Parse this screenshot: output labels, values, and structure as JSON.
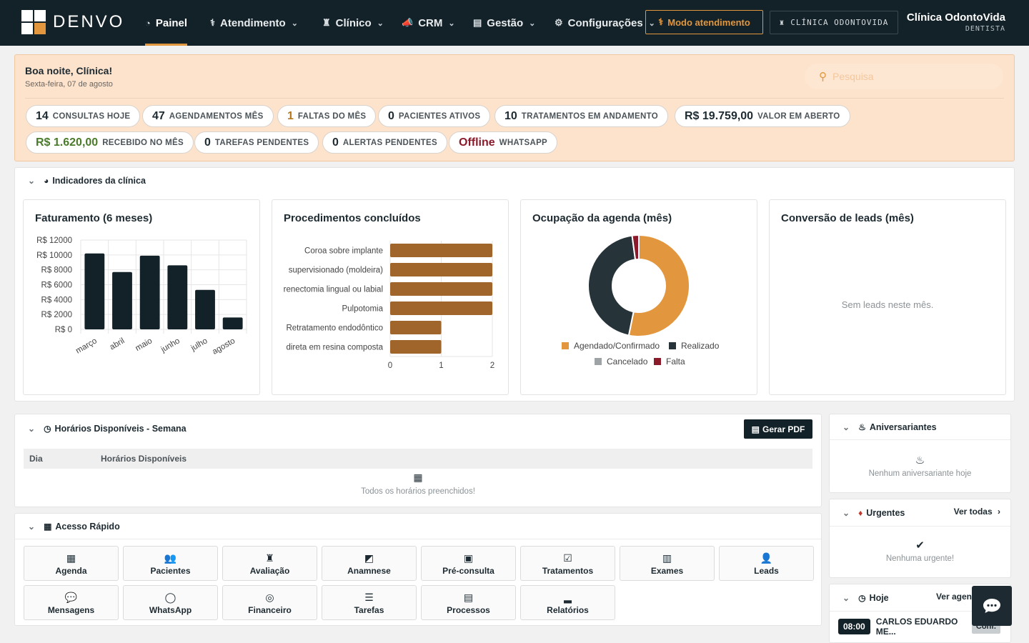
{
  "app": {
    "brand": "DENVO"
  },
  "nav": {
    "items": [
      {
        "label": "Painel",
        "icon": "gauge-icon",
        "glyph": "◔",
        "active": true
      },
      {
        "label": "Atendimento",
        "icon": "stethoscope-icon",
        "glyph": "⚕",
        "dropdown": true
      },
      {
        "label": "Clínico",
        "icon": "tooth-icon",
        "glyph": "♜",
        "dropdown": true
      },
      {
        "label": "CRM",
        "icon": "megaphone-icon",
        "glyph": "📣",
        "dropdown": true
      },
      {
        "label": "Gestão",
        "icon": "briefcase-icon",
        "glyph": "▤",
        "dropdown": true
      },
      {
        "label": "Configurações",
        "icon": "gear-icon",
        "glyph": "⚙",
        "dropdown": true
      }
    ],
    "modo_label": "Modo atendimento",
    "clinic_tag": "CLÍNICA ODONTOVIDA",
    "user_name": "Clínica OdontoVida",
    "user_role": "DENTISTA"
  },
  "greeting": {
    "title": "Boa noite, Clínica!",
    "date": "Sexta-feira, 07 de agosto",
    "search_placeholder": "Pesquisa"
  },
  "stats": [
    {
      "value": "14",
      "label": "CONSULTAS HOJE",
      "color": "#1d2a31"
    },
    {
      "value": "47",
      "label": "AGENDAMENTOS MÊS",
      "color": "#1d2a31"
    },
    {
      "value": "1",
      "label": "FALTAS DO MÊS",
      "color": "#b8781e"
    },
    {
      "value": "0",
      "label": "PACIENTES ATIVOS",
      "color": "#1d2a31"
    },
    {
      "value": "10",
      "label": "TRATAMENTOS EM ANDAMENTO",
      "color": "#1d2a31"
    },
    {
      "value": "R$ 19.759,00",
      "label": "VALOR EM ABERTO",
      "color": "#1d2a31"
    },
    {
      "value": "R$ 1.620,00",
      "label": "RECEBIDO NO MÊS",
      "color": "#4a7a2a"
    },
    {
      "value": "0",
      "label": "TAREFAS PENDENTES",
      "color": "#1d2a31"
    },
    {
      "value": "0",
      "label": "ALERTAS PENDENTES",
      "color": "#1d2a31"
    },
    {
      "value": "Offline",
      "label": "WHATSAPP",
      "color": "#8b1a2a"
    }
  ],
  "indicators": {
    "title": "Indicadores da clínica",
    "cards": {
      "revenue_title": "Faturamento (6 meses)",
      "procedures_title": "Procedimentos concluídos",
      "occupancy_title": "Ocupação da agenda (mês)",
      "leads_title": "Conversão de leads (mês)",
      "leads_empty": "Sem leads neste mês."
    }
  },
  "chart_data": [
    {
      "type": "bar",
      "title": "Faturamento (6 meses)",
      "categories": [
        "março",
        "abril",
        "maio",
        "junho",
        "julho",
        "agosto"
      ],
      "values": [
        10200,
        7700,
        9900,
        8600,
        5300,
        1600
      ],
      "ylim": [
        0,
        12000
      ],
      "yticks": [
        "R$ 0",
        "R$ 2000",
        "R$ 4000",
        "R$ 6000",
        "R$ 8000",
        "R$ 10000",
        "R$ 12000"
      ],
      "color": "#132228",
      "grid": true
    },
    {
      "type": "bar",
      "orientation": "horizontal",
      "title": "Procedimentos concluídos",
      "categories": [
        "Coroa sobre implante",
        "supervisionado (moldeira)",
        "Frenectomia lingual ou labial",
        "Pulpotomia",
        "Retratamento endodôntico",
        "direta em resina composta"
      ],
      "values": [
        2,
        2,
        2,
        2,
        1,
        1
      ],
      "xlim": [
        0,
        2
      ],
      "xticks": [
        "0",
        "1",
        "2"
      ],
      "color": "#a0652a",
      "grid": true
    },
    {
      "type": "pie",
      "style": "donut",
      "title": "Ocupação da agenda (mês)",
      "labels": [
        "Agendado/Confirmado",
        "Realizado",
        "Cancelado",
        "Falta"
      ],
      "values": [
        25,
        21,
        0,
        1
      ],
      "colors": [
        "#e2963d",
        "#263339",
        "#9ea3a6",
        "#8b1a2a"
      ],
      "legend": "bottom"
    }
  ],
  "horarios": {
    "title": "Horários Disponíveis - Semana",
    "pdf_label": "Gerar PDF",
    "col_day": "Dia",
    "col_slots": "Horários Disponíveis",
    "empty": "Todos os horários preenchidos!"
  },
  "quick_access": {
    "title": "Acesso Rápido",
    "items": [
      {
        "label": "Agenda",
        "icon": "calendar-icon",
        "glyph": "▦"
      },
      {
        "label": "Pacientes",
        "icon": "users-icon",
        "glyph": "👥"
      },
      {
        "label": "Avaliação",
        "icon": "tooth-icon",
        "glyph": "♜"
      },
      {
        "label": "Anamnese",
        "icon": "clipboard-icon",
        "glyph": "◩"
      },
      {
        "label": "Pré-consulta",
        "icon": "file-medical-icon",
        "glyph": "▣"
      },
      {
        "label": "Tratamentos",
        "icon": "clipboard-check-icon",
        "glyph": "☑"
      },
      {
        "label": "Exames",
        "icon": "lab-icon",
        "glyph": "▥"
      },
      {
        "label": "Leads",
        "icon": "user-plus-icon",
        "glyph": "👤"
      },
      {
        "label": "Mensagens",
        "icon": "comments-icon",
        "glyph": "💬"
      },
      {
        "label": "WhatsApp",
        "icon": "whatsapp-icon",
        "glyph": "◯"
      },
      {
        "label": "Financeiro",
        "icon": "coins-icon",
        "glyph": "◎"
      },
      {
        "label": "Tarefas",
        "icon": "list-check-icon",
        "glyph": "☰"
      },
      {
        "label": "Processos",
        "icon": "clipboard-list-icon",
        "glyph": "▤"
      },
      {
        "label": "Relatórios",
        "icon": "chart-icon",
        "glyph": "▂"
      }
    ]
  },
  "side": {
    "birthdays_title": "Aniversariantes",
    "birthdays_empty": "Nenhum aniversariante hoje",
    "urgent_title": "Urgentes",
    "urgent_link": "Ver todas",
    "urgent_empty": "Nenhuma urgente!",
    "today_title": "Hoje",
    "today_link": "Ver agenda",
    "today_time": "08:00",
    "today_patient": "CARLOS EDUARDO ME...",
    "today_status": "Conf."
  }
}
